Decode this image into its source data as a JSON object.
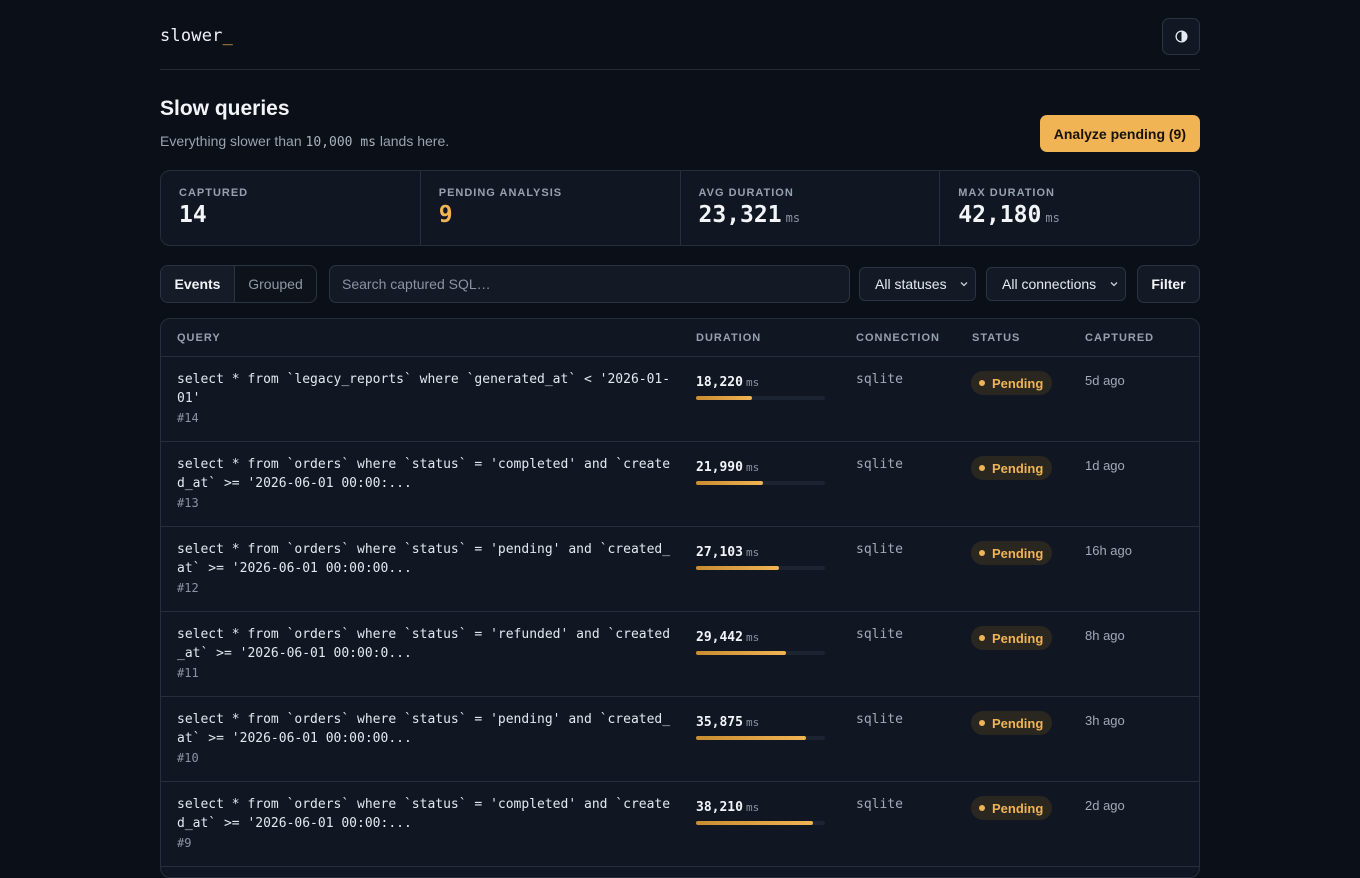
{
  "app": {
    "logo": "slower",
    "logo_cursor": "_"
  },
  "header": {
    "theme_toggle_icon": "half-circle-icon"
  },
  "page": {
    "title": "Slow queries",
    "subtitle_prefix": "Everything slower than",
    "threshold": "10,000 ms",
    "subtitle_suffix": "lands here.",
    "analyze_label": "Analyze pending (9)"
  },
  "stats": [
    {
      "label": "CAPTURED",
      "value": "14",
      "unit": ""
    },
    {
      "label": "PENDING ANALYSIS",
      "value": "9",
      "unit": ""
    },
    {
      "label": "AVG DURATION",
      "value": "23,321",
      "unit": "ms"
    },
    {
      "label": "MAX DURATION",
      "value": "42,180",
      "unit": "ms"
    }
  ],
  "toolbar": {
    "tabs": [
      "Events",
      "Grouped"
    ],
    "search_placeholder": "Search captured SQL…",
    "status_select": "All statuses",
    "connection_select": "All connections",
    "filter_label": "Filter"
  },
  "table": {
    "headers": [
      "QUERY",
      "DURATION",
      "CONNECTION",
      "STATUS",
      "CAPTURED"
    ],
    "rows": [
      {
        "sql": "select * from `legacy_reports` where `generated_at` < '2026-01-01'",
        "id": "#14",
        "duration": "18,220",
        "unit": "ms",
        "duration_ms": 18220,
        "connection": "sqlite",
        "status": "Pending",
        "captured": "5d ago"
      },
      {
        "sql": "select * from `orders` where `status` = 'completed' and `created_at` >= '2026-06-01 00:00:...",
        "id": "#13",
        "duration": "21,990",
        "unit": "ms",
        "duration_ms": 21990,
        "connection": "sqlite",
        "status": "Pending",
        "captured": "1d ago"
      },
      {
        "sql": "select * from `orders` where `status` = 'pending' and `created_at` >= '2026-06-01 00:00:00...",
        "id": "#12",
        "duration": "27,103",
        "unit": "ms",
        "duration_ms": 27103,
        "connection": "sqlite",
        "status": "Pending",
        "captured": "16h ago"
      },
      {
        "sql": "select * from `orders` where `status` = 'refunded' and `created_at` >= '2026-06-01 00:00:0...",
        "id": "#11",
        "duration": "29,442",
        "unit": "ms",
        "duration_ms": 29442,
        "connection": "sqlite",
        "status": "Pending",
        "captured": "8h ago"
      },
      {
        "sql": "select * from `orders` where `status` = 'pending' and `created_at` >= '2026-06-01 00:00:00...",
        "id": "#10",
        "duration": "35,875",
        "unit": "ms",
        "duration_ms": 35875,
        "connection": "sqlite",
        "status": "Pending",
        "captured": "3h ago"
      },
      {
        "sql": "select * from `orders` where `status` = 'completed' and `created_at` >= '2026-06-01 00:00:...",
        "id": "#9",
        "duration": "38,210",
        "unit": "ms",
        "duration_ms": 38210,
        "connection": "sqlite",
        "status": "Pending",
        "captured": "2d ago"
      }
    ],
    "max_duration_ms": 42180
  },
  "colors": {
    "accent": "#f0b455",
    "background": "#0b0f17",
    "panel": "#111722"
  }
}
